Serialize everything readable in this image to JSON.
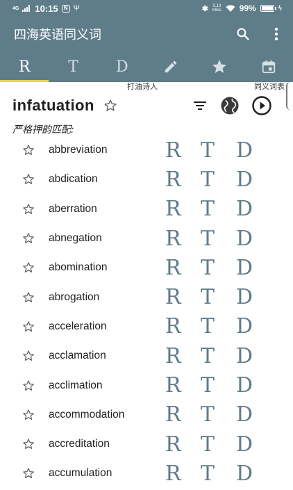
{
  "status_bar": {
    "network": "4G",
    "time": "10:15",
    "nfc": "N",
    "speed_value": "0.10",
    "speed_unit": "KB/s",
    "battery": "99%",
    "battery_level": 0.99
  },
  "app_bar": {
    "title": "四海英语同义词",
    "search_icon": "search-icon",
    "menu_icon": "more-vert-icon"
  },
  "tabs": [
    {
      "label": "R",
      "active": true
    },
    {
      "label": "T",
      "active": false
    },
    {
      "label": "D",
      "active": false
    },
    {
      "label": "pencil-icon",
      "active": false
    },
    {
      "label": "star-icon",
      "active": false
    },
    {
      "label": "calendar-icon",
      "active": false
    }
  ],
  "caption_strip": {
    "left_text": "打油诗人",
    "right_text": "同义词表"
  },
  "header": {
    "word": "infatuation",
    "actions": [
      "filter-icon",
      "globe-icon",
      "play-icon"
    ]
  },
  "section_label": "严格押韵匹配:",
  "rtd_labels": [
    "R",
    "T",
    "D"
  ],
  "words": [
    "abbreviation",
    "abdication",
    "aberration",
    "abnegation",
    "abomination",
    "abrogation",
    "acceleration",
    "acclamation",
    "acclimation",
    "accommodation",
    "accreditation",
    "accumulation"
  ],
  "colors": {
    "primary": "#5f7c89",
    "tab_indicator": "#e6d74c",
    "text": "#212121"
  }
}
